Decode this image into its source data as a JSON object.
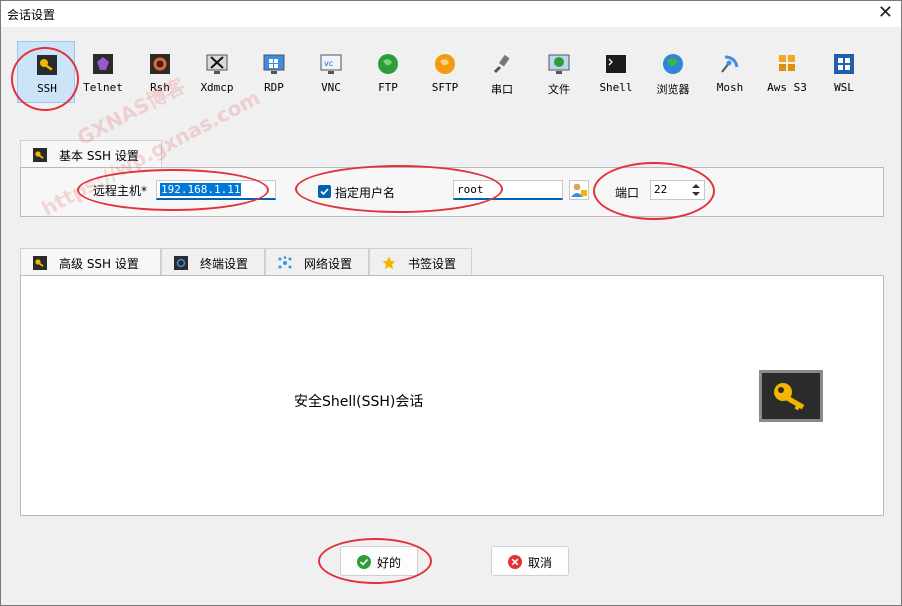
{
  "window": {
    "title": "会话设置",
    "close_symbol": "✕"
  },
  "session_types": [
    {
      "label": "SSH",
      "icon": "key-icon",
      "selected": true
    },
    {
      "label": "Telnet",
      "icon": "telnet-icon"
    },
    {
      "label": "Rsh",
      "icon": "rsh-icon"
    },
    {
      "label": "Xdmcp",
      "icon": "xdmcp-icon"
    },
    {
      "label": "RDP",
      "icon": "rdp-icon"
    },
    {
      "label": "VNC",
      "icon": "vnc-icon"
    },
    {
      "label": "FTP",
      "icon": "ftp-icon"
    },
    {
      "label": "SFTP",
      "icon": "sftp-icon"
    },
    {
      "label": "串口",
      "icon": "serial-icon"
    },
    {
      "label": "文件",
      "icon": "file-icon"
    },
    {
      "label": "Shell",
      "icon": "shell-icon"
    },
    {
      "label": "浏览器",
      "icon": "browser-icon"
    },
    {
      "label": "Mosh",
      "icon": "mosh-icon"
    },
    {
      "label": "Aws S3",
      "icon": "aws-s3-icon"
    },
    {
      "label": "WSL",
      "icon": "wsl-icon"
    }
  ],
  "basic_tab": {
    "label": "基本 SSH 设置"
  },
  "basic": {
    "remote_host_label": "远程主机*",
    "remote_host_value": "192.168.1.11",
    "specify_user_label": "指定用户名",
    "username_value": "root",
    "port_label": "端口",
    "port_value": "22"
  },
  "advanced_tabs": [
    {
      "label": "高级 SSH 设置",
      "icon": "key-icon"
    },
    {
      "label": "终端设置",
      "icon": "terminal-icon"
    },
    {
      "label": "网络设置",
      "icon": "network-icon"
    },
    {
      "label": "书签设置",
      "icon": "star-icon"
    }
  ],
  "description": "安全Shell(SSH)会话",
  "buttons": {
    "ok": "好的",
    "cancel": "取消"
  },
  "watermark": [
    "GXNAS博客",
    "https://wp.gxnas.com"
  ],
  "colors": {
    "accent": "#0063b1",
    "highlight": "#e3313a",
    "key_bg": "#2b2b2b",
    "key_gold": "#f2b600"
  }
}
